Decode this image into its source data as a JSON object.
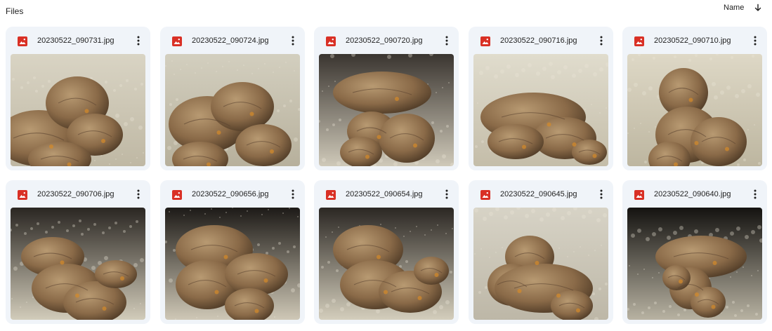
{
  "header": {
    "title": "Files"
  },
  "sort": {
    "label": "Name",
    "direction_icon": "arrow-down-icon"
  },
  "accent_color": "#f0f4f9",
  "file_icon_color": "#d93025",
  "files": [
    {
      "name": "20230522_090731.jpg",
      "icon": "image-file-icon"
    },
    {
      "name": "20230522_090724.jpg",
      "icon": "image-file-icon"
    },
    {
      "name": "20230522_090720.jpg",
      "icon": "image-file-icon"
    },
    {
      "name": "20230522_090716.jpg",
      "icon": "image-file-icon"
    },
    {
      "name": "20230522_090710.jpg",
      "icon": "image-file-icon"
    },
    {
      "name": "20230522_090706.jpg",
      "icon": "image-file-icon"
    },
    {
      "name": "20230522_090656.jpg",
      "icon": "image-file-icon"
    },
    {
      "name": "20230522_090654.jpg",
      "icon": "image-file-icon"
    },
    {
      "name": "20230522_090645.jpg",
      "icon": "image-file-icon"
    },
    {
      "name": "20230522_090640.jpg",
      "icon": "image-file-icon"
    }
  ]
}
